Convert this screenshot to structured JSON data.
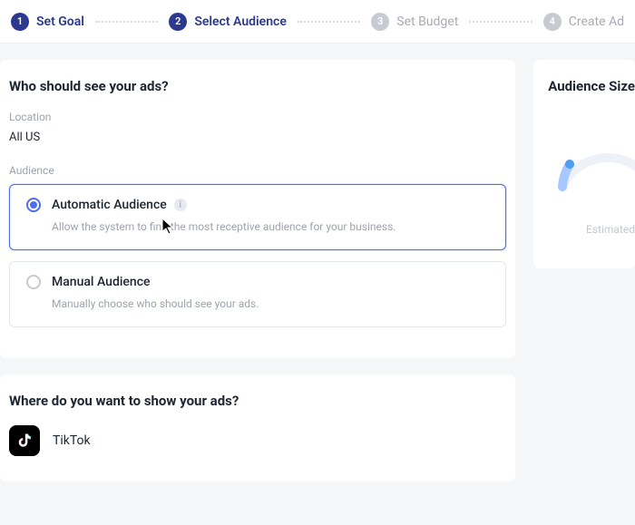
{
  "stepper": {
    "steps": [
      {
        "num": "1",
        "label": "Set Goal",
        "state": "done"
      },
      {
        "num": "2",
        "label": "Select Audience",
        "state": "done"
      },
      {
        "num": "3",
        "label": "Set Budget",
        "state": "pending"
      },
      {
        "num": "4",
        "label": "Create Ad",
        "state": "pending"
      }
    ]
  },
  "audience_section": {
    "title": "Who should see your ads?",
    "location_label": "Location",
    "location_value": "All US",
    "audience_label": "Audience",
    "options": {
      "automatic": {
        "title": "Automatic Audience",
        "desc": "Allow the system to find the most receptive audience for your business.",
        "selected": true
      },
      "manual": {
        "title": "Manual Audience",
        "desc": "Manually choose who should see your ads.",
        "selected": false
      }
    }
  },
  "placement_section": {
    "title": "Where do you want to show your ads?",
    "placement": "TikTok"
  },
  "side_panel": {
    "title": "Audience Size",
    "caption": "Estimated"
  },
  "colors": {
    "brand_navy": "#2b3a8f",
    "accent_blue": "#4d6df0",
    "muted": "#9ea3ad"
  }
}
